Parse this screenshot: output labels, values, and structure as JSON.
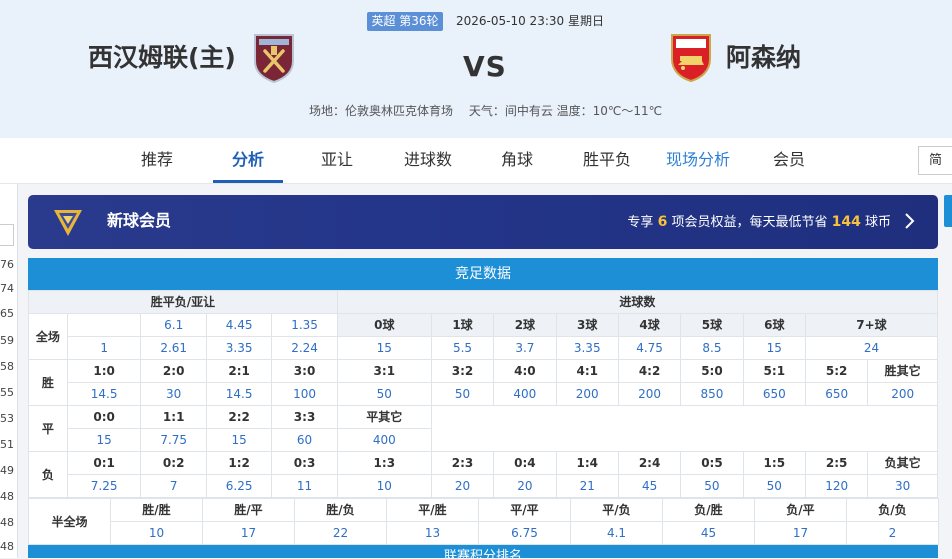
{
  "match": {
    "league_round": "英超 第36轮",
    "datetime": "2026-05-10 23:30 星期日",
    "home_team": "西汉姆联(主)",
    "home_crest": "west-ham-crest",
    "vs": "VS",
    "away_team": "阿森纳",
    "away_crest": "arsenal-crest",
    "venue": "场地：伦敦奥林匹克体育场",
    "weather": "天气：间中有云 温度：10℃～11℃"
  },
  "tabs": [
    {
      "label": "推荐"
    },
    {
      "label": "分析",
      "active": true
    },
    {
      "label": "亚让"
    },
    {
      "label": "进球数"
    },
    {
      "label": "角球"
    },
    {
      "label": "胜平负"
    },
    {
      "label": "现场分析"
    },
    {
      "label": "会员"
    }
  ],
  "jian_button": "简",
  "left_stub": [
    "76",
    "74",
    "65",
    "59",
    "58",
    "55",
    "53",
    "51",
    "49",
    "48",
    "48",
    "48"
  ],
  "member": {
    "title": "新球会员",
    "desc_pre": "专享",
    "desc_count": "6",
    "desc_mid": "项会员权益，每天最低节省",
    "desc_coins": "144",
    "desc_post": "球币"
  },
  "jingzu": {
    "title": "竞足数据",
    "sec_wdl": "胜平负/亚让",
    "sec_goals": "进球数",
    "full_label": "全场",
    "wdl_row1": [
      "6.1",
      "4.45",
      "1.35"
    ],
    "wdl_row2": [
      "1",
      "2.61",
      "3.35",
      "2.24"
    ],
    "goals_labels": [
      "0球",
      "1球",
      "2球",
      "3球",
      "4球",
      "5球",
      "6球",
      "7+球"
    ],
    "goals_odds": [
      "15",
      "5.5",
      "3.7",
      "3.35",
      "4.75",
      "8.5",
      "15",
      "24"
    ],
    "win_label": "胜",
    "win_scores": [
      "1:0",
      "2:0",
      "2:1",
      "3:0",
      "3:1",
      "3:2",
      "4:0",
      "4:1",
      "4:2",
      "5:0",
      "5:1",
      "5:2",
      "胜其它"
    ],
    "win_odds": [
      "14.5",
      "30",
      "14.5",
      "100",
      "50",
      "50",
      "400",
      "200",
      "200",
      "850",
      "650",
      "650",
      "200"
    ],
    "draw_label": "平",
    "draw_scores": [
      "0:0",
      "1:1",
      "2:2",
      "3:3",
      "平其它"
    ],
    "draw_odds": [
      "15",
      "7.75",
      "15",
      "60",
      "400"
    ],
    "lose_label": "负",
    "lose_scores": [
      "0:1",
      "0:2",
      "1:2",
      "0:3",
      "1:3",
      "2:3",
      "0:4",
      "1:4",
      "2:4",
      "0:5",
      "1:5",
      "2:5",
      "负其它"
    ],
    "lose_odds": [
      "7.25",
      "7",
      "6.25",
      "11",
      "10",
      "20",
      "20",
      "21",
      "45",
      "50",
      "50",
      "120",
      "30"
    ],
    "half_label": "半全场",
    "half_items": [
      "胜/胜",
      "胜/平",
      "胜/负",
      "平/胜",
      "平/平",
      "平/负",
      "负/胜",
      "负/平",
      "负/负"
    ],
    "half_odds": [
      "10",
      "17",
      "22",
      "13",
      "6.75",
      "4.1",
      "45",
      "17",
      "2"
    ]
  },
  "next_section": "联赛积分排名",
  "colors": {
    "accent": "#1d8fd6",
    "tab_active": "#1f5fb7",
    "odds": "#2f6fc6",
    "gold": "#f6c23e"
  }
}
